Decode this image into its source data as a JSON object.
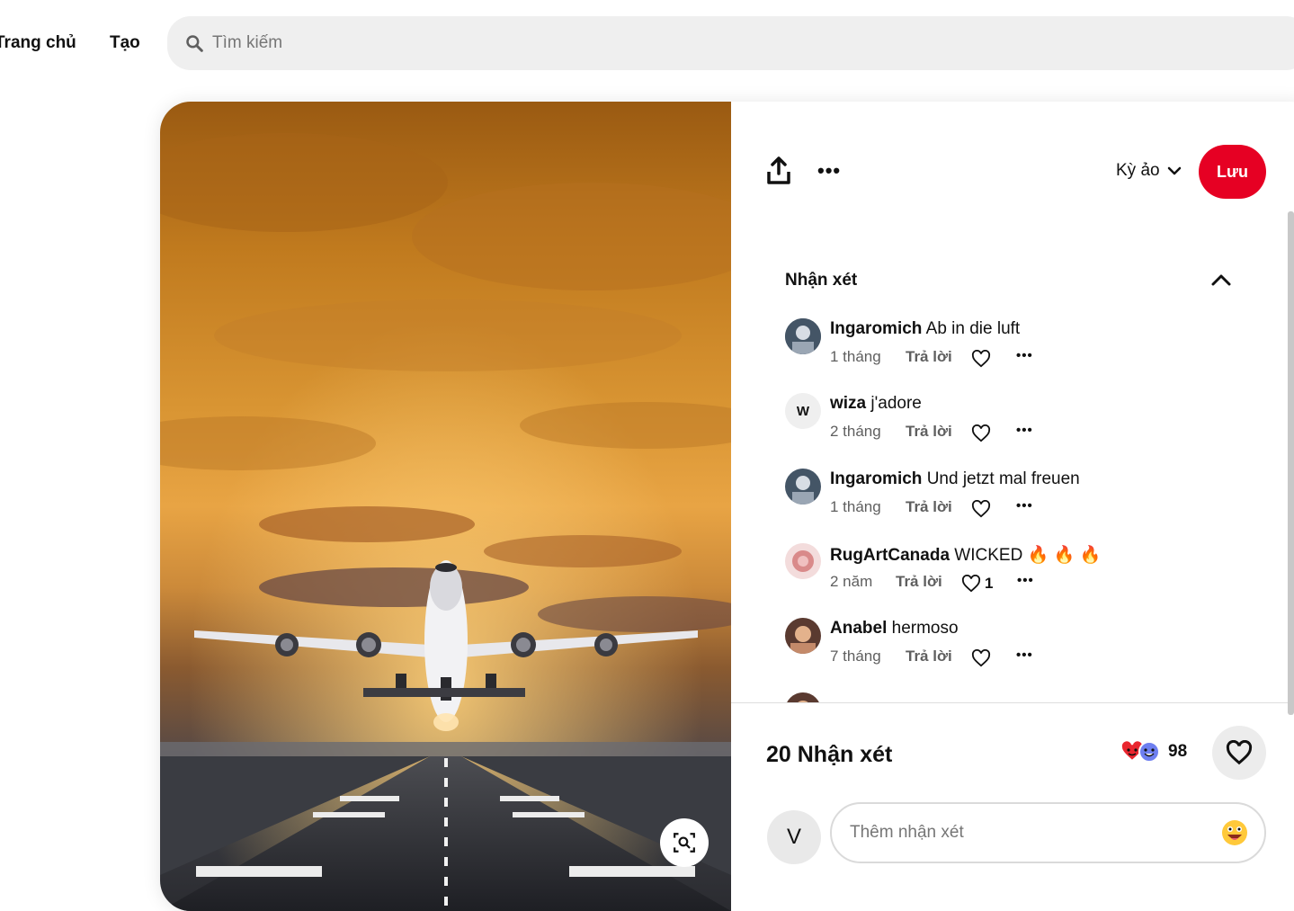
{
  "nav": {
    "home_label": "Trang chủ",
    "create_label": "Tạo"
  },
  "search": {
    "placeholder": "Tìm kiếm",
    "value": "",
    "icon": "search-icon"
  },
  "pin": {
    "image_description_icon": "lens-icon",
    "toolbar": {
      "share_icon": "share-icon",
      "more_icon": "more-icon"
    },
    "board": {
      "name": "Kỳ ảo"
    },
    "save_label": "Lưu",
    "comments_title": "Nhận xét",
    "comments": [
      {
        "user": "Ingaromich",
        "text": "Ab in die luft",
        "time": "1 tháng",
        "reply_label": "Trả lời",
        "likes": "",
        "avatar": ""
      },
      {
        "user": "wiza",
        "text": "j'adore",
        "time": "2 tháng",
        "reply_label": "Trả lời",
        "likes": "",
        "avatar": "W"
      },
      {
        "user": "Ingaromich",
        "text": "Und jetzt mal freuen",
        "time": "1 tháng",
        "reply_label": "Trả lời",
        "likes": "",
        "avatar": ""
      },
      {
        "user": "RugArtCanada",
        "text": "WICKED 🔥 🔥 🔥",
        "time": "2 năm",
        "reply_label": "Trả lời",
        "likes": "1",
        "avatar": ""
      },
      {
        "user": "Anabel",
        "text": "hermoso",
        "time": "7 tháng",
        "reply_label": "Trả lời",
        "likes": "",
        "avatar": ""
      }
    ],
    "comment_count_label": "20 Nhận xét",
    "reaction_count": "98",
    "my_avatar": "V",
    "comment_placeholder": "Thêm nhận xét",
    "colors": {
      "save": "#e60023",
      "sky": "#e8a444"
    }
  }
}
